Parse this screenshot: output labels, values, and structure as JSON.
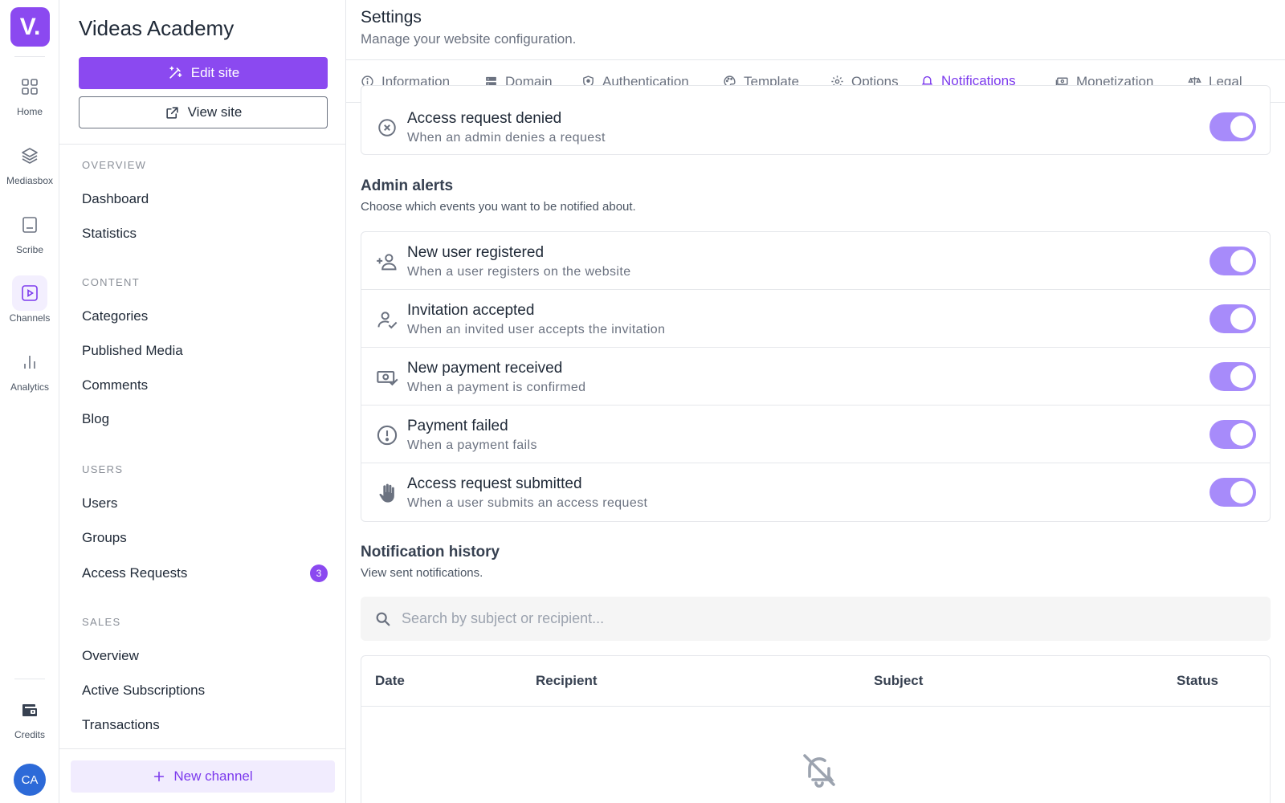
{
  "rail": {
    "logo": "V.",
    "items": [
      {
        "label": "Home",
        "icon": "grid-icon"
      },
      {
        "label": "Mediasbox",
        "icon": "layers-icon"
      },
      {
        "label": "Scribe",
        "icon": "document-icon"
      },
      {
        "label": "Channels",
        "icon": "play-square-icon",
        "active": true
      },
      {
        "label": "Analytics",
        "icon": "bar-chart-icon"
      }
    ],
    "credits_label": "Credits",
    "avatar": "CA"
  },
  "sidebar": {
    "site_name": "Videas Academy",
    "edit_label": "Edit site",
    "view_label": "View site",
    "sections": {
      "overview": "OVERVIEW",
      "content": "CONTENT",
      "users": "USERS",
      "sales": "SALES"
    },
    "overview_items": [
      "Dashboard",
      "Statistics"
    ],
    "content_items": [
      "Categories",
      "Published Media",
      "Comments",
      "Blog"
    ],
    "users_items": [
      "Users",
      "Groups",
      "Access Requests"
    ],
    "access_requests_count": "3",
    "sales_items": [
      "Overview",
      "Active Subscriptions",
      "Transactions"
    ],
    "new_channel_label": "New channel"
  },
  "header": {
    "title": "Settings",
    "subtitle": "Manage your website configuration."
  },
  "tabs": [
    {
      "label": "Information",
      "icon": "info-icon"
    },
    {
      "label": "Domain",
      "icon": "server-icon"
    },
    {
      "label": "Authentication",
      "icon": "shield-icon"
    },
    {
      "label": "Template",
      "icon": "palette-icon"
    },
    {
      "label": "Options",
      "icon": "gear-icon"
    },
    {
      "label": "Notifications",
      "icon": "bell-icon",
      "active": true
    },
    {
      "label": "Monetization",
      "icon": "money-icon"
    },
    {
      "label": "Legal",
      "icon": "scale-icon"
    }
  ],
  "user_notifications": [
    {
      "title": "Access request denied",
      "desc": "When an admin denies a request",
      "enabled": true,
      "icon": "circle-x-icon"
    }
  ],
  "admin_alerts": {
    "title": "Admin alerts",
    "subtitle": "Choose which events you want to be notified about.",
    "items": [
      {
        "title": "New user registered",
        "desc": "When a user registers on the website",
        "enabled": true,
        "icon": "user-plus-icon"
      },
      {
        "title": "Invitation accepted",
        "desc": "When an invited user accepts the invitation",
        "enabled": true,
        "icon": "user-check-icon"
      },
      {
        "title": "New payment received",
        "desc": "When a payment is confirmed",
        "enabled": true,
        "icon": "payment-check-icon"
      },
      {
        "title": "Payment failed",
        "desc": "When a payment fails",
        "enabled": true,
        "icon": "alert-circle-icon"
      },
      {
        "title": "Access request submitted",
        "desc": "When a user submits an access request",
        "enabled": true,
        "icon": "hand-icon"
      }
    ]
  },
  "history": {
    "title": "Notification history",
    "subtitle": "View sent notifications.",
    "search_placeholder": "Search by subject or recipient...",
    "columns": [
      "Date",
      "Recipient",
      "Subject",
      "Status"
    ],
    "empty_icon": "bell-off-icon"
  },
  "colors": {
    "accent": "#8b49f0",
    "toggle_on": "#a78bfa",
    "avatar": "#2d6ad8"
  }
}
